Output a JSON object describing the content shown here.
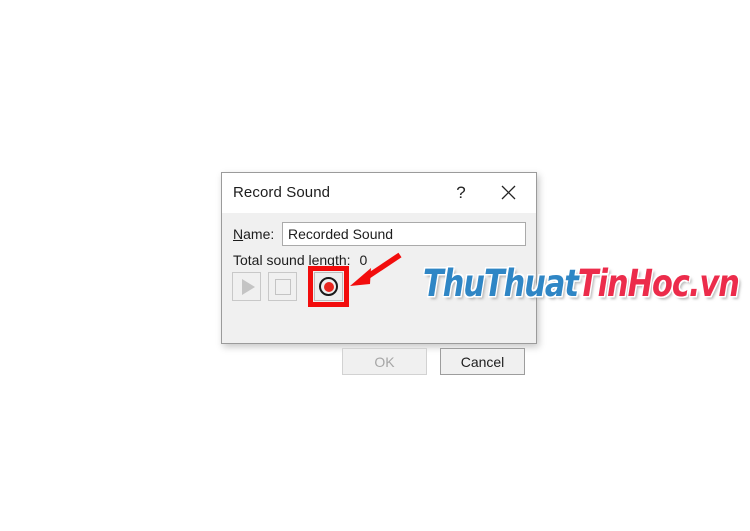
{
  "dialog": {
    "title": "Record Sound",
    "titlebar_buttons": [
      {
        "name": "help-button",
        "label": "?"
      },
      {
        "name": "close-button",
        "label": "✕"
      }
    ],
    "name_field": {
      "label_accel": "N",
      "label_rest": "ame:",
      "value": "Recorded Sound",
      "placeholder": "Recorded Sound"
    },
    "sound_length": {
      "label": "Total sound length:",
      "value": "0"
    },
    "media_buttons": [
      {
        "name": "play-button",
        "icon": "play-icon",
        "state": "disabled"
      },
      {
        "name": "stop-button",
        "icon": "stop-icon",
        "state": "disabled"
      },
      {
        "name": "record-button",
        "icon": "record-icon",
        "state": "enabled"
      }
    ],
    "actions": [
      {
        "name": "ok-button",
        "label": "OK",
        "state": "disabled"
      },
      {
        "name": "cancel-button",
        "label": "Cancel",
        "state": "enabled"
      }
    ]
  },
  "annotation": {
    "arrow_color": "#f20d0d",
    "highlight_color": "#f20d0d",
    "target": "record-button"
  },
  "watermark": {
    "part_blue": "ThuThuat",
    "part_red": "TinHoc.vn",
    "blue_color": "#2f86c5",
    "red_color": "#ec2c4b"
  }
}
